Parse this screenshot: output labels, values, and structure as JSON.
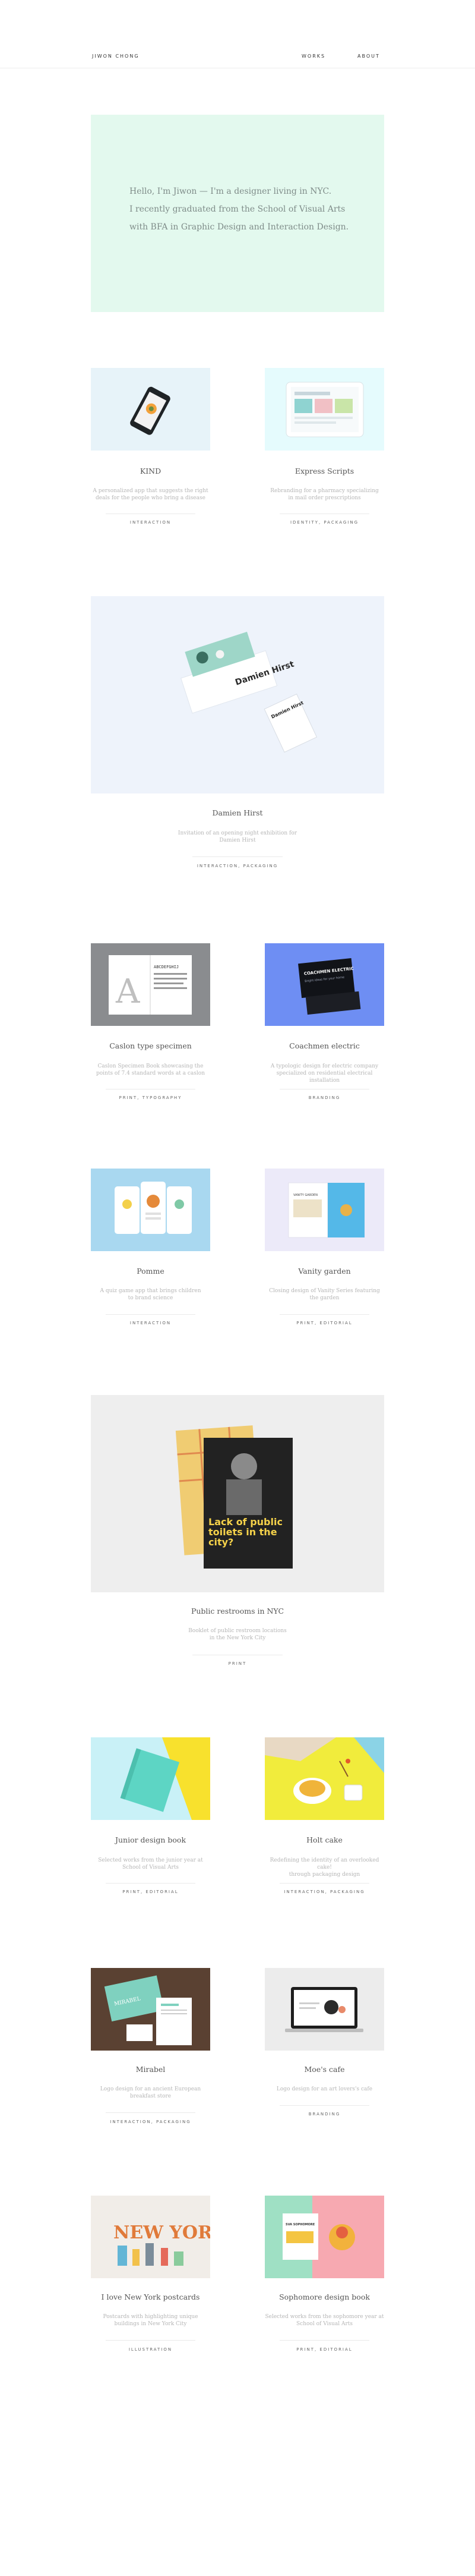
{
  "header": {
    "logo": "JIWON CHONG",
    "nav": [
      {
        "label": "WORKS"
      },
      {
        "label": "ABOUT"
      }
    ]
  },
  "hero": {
    "lines": [
      "Hello, I'm Jiwon — I'm a designer living in NYC.",
      "I recently graduated from the School of Visual Arts",
      "with BFA in Graphic Design and Interaction Design."
    ]
  },
  "projects": [
    {
      "title": "KIND",
      "desc1": "A personalized app that suggests the right",
      "desc2": "deals for the people who bring a disease",
      "tags": "INTERACTION"
    },
    {
      "title": "Express Scripts",
      "desc1": "Rebranding for a pharmacy specializing",
      "desc2": "in mail order prescriptions",
      "tags": "IDENTITY, PACKAGING"
    },
    {
      "title": "Damien Hirst",
      "desc1": "Invitation of an opening night exhibition for",
      "desc2": "Damien Hirst",
      "tags": "INTERACTION, PACKAGING"
    },
    {
      "title": "Caslon type specimen",
      "desc1": "Caslon Specimen Book showcasing the",
      "desc2": "points of 7.4 standard words at a caslon",
      "tags": "PRINT, TYPOGRAPHY"
    },
    {
      "title": "Coachmen electric",
      "desc1": "A typologic design for electric company",
      "desc2": "specialized on residential electrical installation",
      "tags": "BRANDING"
    },
    {
      "title": "Pomme",
      "desc1": "A quiz game app that brings children",
      "desc2": "to brand science",
      "tags": "INTERACTION"
    },
    {
      "title": "Vanity garden",
      "desc1": "Closing design of Vanity Series featuring",
      "desc2": "the garden",
      "tags": "PRINT, EDITORIAL"
    },
    {
      "title": "Public restrooms in NYC",
      "desc1": "Booklet of public restroom locations",
      "desc2": "in the New York City",
      "tags": "PRINT"
    },
    {
      "title": "Junior design book",
      "desc1": "Selected works from the junior year at",
      "desc2": "School of Visual Arts",
      "tags": "PRINT, EDITORIAL"
    },
    {
      "title": "Holt cake",
      "desc1": "Redefining the identity of an overlooked cake!",
      "desc2": "through packaging design",
      "tags": "INTERACTION, PACKAGING"
    },
    {
      "title": "Mirabel",
      "desc1": "Logo design for an ancient European",
      "desc2": "breakfast store",
      "tags": "INTERACTION, PACKAGING"
    },
    {
      "title": "Moe's cafe",
      "desc1": "Logo design for an art lovers's cafe",
      "desc2": "",
      "tags": "BRANDING"
    },
    {
      "title": "I love New York postcards",
      "desc1": "Postcards with highlighting unique",
      "desc2": "buildings in New York City",
      "tags": "ILLUSTRATION"
    },
    {
      "title": "Sophomore design book",
      "desc1": "Selected works from the sophomore year at",
      "desc2": "School of Visual Arts",
      "tags": "PRINT, EDITORIAL"
    }
  ],
  "art": {
    "caslon_letters": "ABCDEFGHIJ",
    "coachmen_card": "COACHMEN ELECTRIC",
    "coachmen_caption": "Bright ideas for your home",
    "damien_box": "Damien Hirst",
    "damien_card": "Damien Hirst",
    "restroom_headline": "Lack of public toilets in the city?",
    "ny_text": "NEW YORK",
    "vanity_label": "VANITY GARDEN",
    "mirabel_label": "MIRABEL",
    "sophomore_label": "SVA SOPHOMORE"
  }
}
